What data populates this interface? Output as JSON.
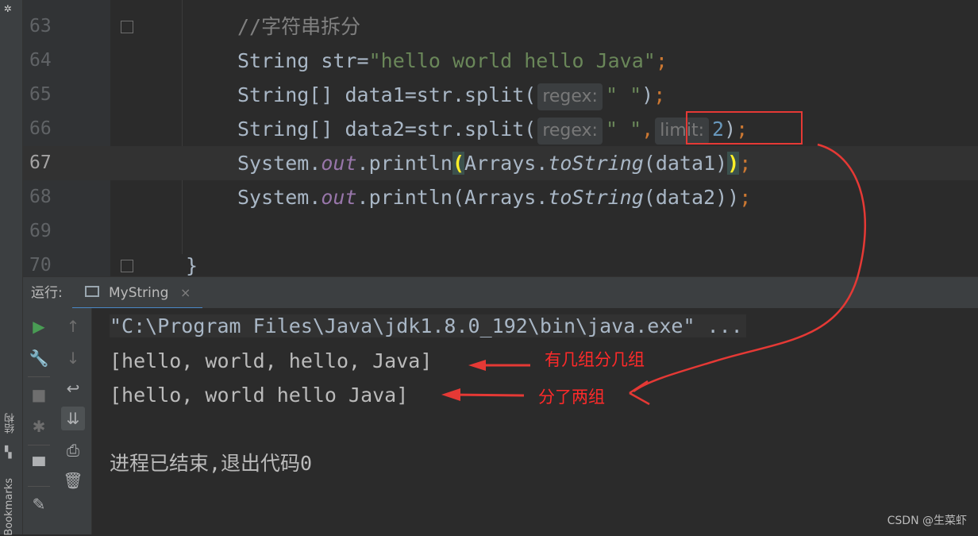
{
  "editor": {
    "lines": [
      {
        "num": "63",
        "code": "//字符串拆分"
      },
      {
        "num": "64",
        "code": "String str=\"hello world hello Java\";"
      },
      {
        "num": "65",
        "code": "String[] data1=str.split( regex: \" \");"
      },
      {
        "num": "66",
        "code": "String[] data2=str.split( regex: \" \", limit: 2);"
      },
      {
        "num": "67",
        "code": "System.out.println(Arrays.toString(data1));"
      },
      {
        "num": "68",
        "code": "System.out.println(Arrays.toString(data2));"
      },
      {
        "num": "69",
        "code": ""
      },
      {
        "num": "70",
        "code": "}"
      }
    ],
    "current_line": "67",
    "hints": {
      "regex": "regex:",
      "limit": "limit:"
    },
    "tokens": {
      "comment": "//字符串拆分",
      "type_string": "String",
      "type_string_arr": "String[]",
      "var_str": "str",
      "lit_hello": "\"hello world hello Java\"",
      "data1_decl": "data1=str.split(",
      "data2_decl": "data2=str.split(",
      "space_lit": "\" \"",
      "limit_val": "2",
      "system": "System.",
      "out": "out",
      "println": ".println",
      "arrays": "Arrays.",
      "tostring": "toString",
      "arg1": "(data1)",
      "arg2": "(data2)",
      "close_brace": "}"
    }
  },
  "run_panel": {
    "label": "运行:",
    "tab_name": "MyString",
    "tab_close": "×",
    "console_lines": [
      "\"C:\\Program Files\\Java\\jdk1.8.0_192\\bin\\java.exe\" ...",
      "[hello, world, hello, Java]",
      "[hello, world hello Java]",
      "",
      "进程已结束,退出代码0"
    ]
  },
  "side_labels": {
    "structure": "结构",
    "bookmarks": "Bookmarks"
  },
  "annotations": {
    "line1": "有几组分几组",
    "line2": "分了两组"
  },
  "colors": {
    "annotation_red": "#e53935",
    "accent": "#4a88c7"
  },
  "watermark": "CSDN @生菜虾"
}
